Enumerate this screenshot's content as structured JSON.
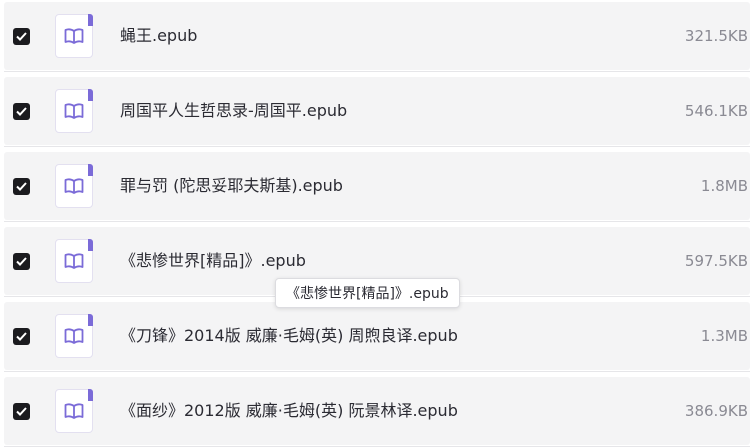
{
  "files": [
    {
      "name": "蝇王.epub",
      "size": "321.5KB",
      "checked": true
    },
    {
      "name": "周国平人生哲思录-周国平.epub",
      "size": "546.1KB",
      "checked": true
    },
    {
      "name": "罪与罚 (陀思妥耶夫斯基).epub",
      "size": "1.8MB",
      "checked": true
    },
    {
      "name": "《悲惨世界[精品]》.epub",
      "size": "597.5KB",
      "checked": true
    },
    {
      "name": "《刀锋》2014版 威廉·毛姆(英) 周煦良译.epub",
      "size": "1.3MB",
      "checked": true
    },
    {
      "name": "《面纱》2012版 威廉·毛姆(英) 阮景林译.epub",
      "size": "386.9KB",
      "checked": true
    }
  ],
  "tooltip": {
    "text": "《悲惨世界[精品]》.epub"
  },
  "icons": {
    "checkbox": "checkmark-icon",
    "file": "book-icon"
  },
  "colors": {
    "accent": "#7b6bd8",
    "checkbox": "#1b1b1f",
    "row_bg": "#f4f4f5"
  }
}
